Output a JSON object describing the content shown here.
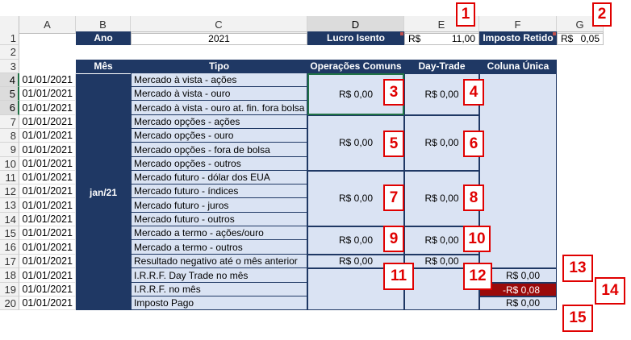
{
  "columns": [
    "A",
    "B",
    "C",
    "D",
    "E",
    "F",
    "G"
  ],
  "rows": [
    "1",
    "2",
    "3",
    "4",
    "5",
    "6",
    "7",
    "8",
    "9",
    "10",
    "11",
    "12",
    "13",
    "14",
    "15",
    "16",
    "17",
    "18",
    "19",
    "20"
  ],
  "header_row": {
    "ano_label": "Ano",
    "ano_value": "2021",
    "lucro_label": "Lucro Isento",
    "lucro_currency": "R$",
    "lucro_value": "11,00",
    "imposto_label": "Imposto Retido",
    "imposto_currency": "R$",
    "imposto_value": "0,05"
  },
  "table_headers": {
    "mes": "Mês",
    "tipo": "Tipo",
    "operacoes": "Operações Comuns",
    "daytrade": "Day-Trade",
    "coluna_unica": "Coluna Única"
  },
  "month": "jan/21",
  "dates": [
    "01/01/2021",
    "01/01/2021",
    "01/01/2021",
    "01/01/2021",
    "01/01/2021",
    "01/01/2021",
    "01/01/2021",
    "01/01/2021",
    "01/01/2021",
    "01/01/2021",
    "01/01/2021",
    "01/01/2021",
    "01/01/2021",
    "01/01/2021",
    "01/01/2021",
    "01/01/2021",
    "01/01/2021"
  ],
  "tipos": [
    "Mercado à vista - ações",
    "Mercado à vista - ouro",
    "Mercado à vista - ouro at. fin. fora bolsa",
    "Mercado opções - ações",
    "Mercado opções - ouro",
    "Mercado opções - fora de bolsa",
    "Mercado opções - outros",
    "Mercado futuro - dólar dos EUA",
    "Mercado futuro - índices",
    "Mercado futuro - juros",
    "Mercado futuro - outros",
    "Mercado a termo - ações/ouro",
    "Mercado a termo - outros",
    "Resultado negativo até o mês anterior",
    "I.R.R.F. Day Trade no mês",
    "I.R.R.F. no mês",
    "Imposto Pago"
  ],
  "values": {
    "op_avista": "R$ 0,00",
    "dt_avista": "R$ 0,00",
    "op_opcoes": "R$ 0,00",
    "dt_opcoes": "R$ 0,00",
    "op_futuro": "R$ 0,00",
    "dt_futuro": "R$ 0,00",
    "op_termo": "R$ 0,00",
    "dt_termo": "R$ 0,00",
    "op_resultado": "R$ 0,00",
    "dt_resultado": "R$ 0,00",
    "f_irrf_dt": "R$ 0,00",
    "f_irrf_mes": "-R$ 0,08",
    "f_imposto_pago": "R$ 0,00"
  },
  "badges": [
    "1",
    "2",
    "3",
    "4",
    "5",
    "6",
    "7",
    "8",
    "9",
    "10",
    "11",
    "12",
    "13",
    "14",
    "15"
  ],
  "colors": {
    "navy": "#1f3864",
    "light_blue": "#dae3f3",
    "negative_fill": "#9b0a0a",
    "badge_red": "#e00000",
    "excel_green": "#217346"
  }
}
